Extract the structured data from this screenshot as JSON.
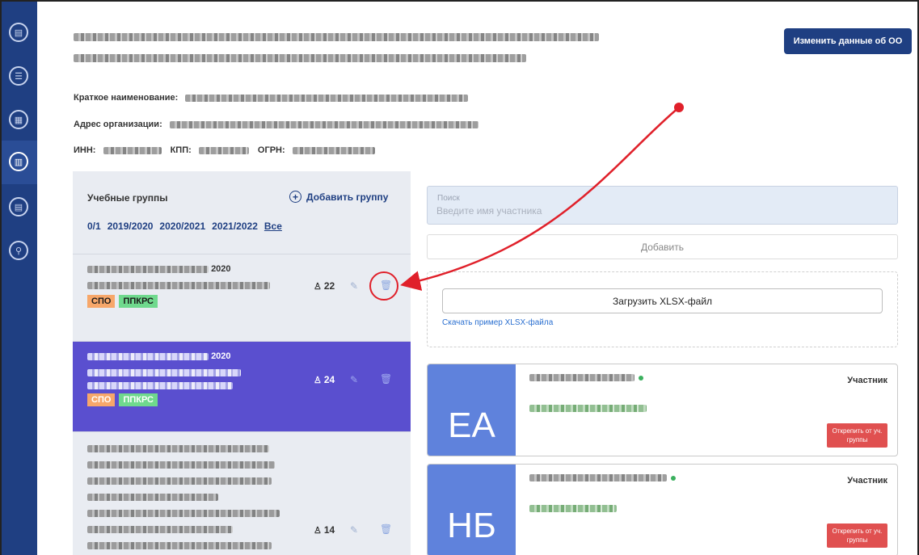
{
  "sidebar": {
    "items": [
      {
        "icon": "document-icon",
        "glyph": "▤"
      },
      {
        "icon": "list-icon",
        "glyph": "☰"
      },
      {
        "icon": "building-icon",
        "glyph": "▦"
      },
      {
        "icon": "calculator-icon",
        "glyph": "▥"
      },
      {
        "icon": "report-icon",
        "glyph": "▤"
      },
      {
        "icon": "user-icon",
        "glyph": "⚲"
      }
    ]
  },
  "header": {
    "edit_button": "Изменить данные об ОО"
  },
  "org": {
    "short_name_label": "Краткое наименование:",
    "address_label": "Адрес организации:",
    "inn_label": "ИНН:",
    "kpp_label": "КПП:",
    "ogrn_label": "ОГРН:"
  },
  "groups": {
    "title": "Учебные группы",
    "add_label": "Добавить группу",
    "years": [
      "0/1",
      "2019/2020",
      "2020/2021",
      "2021/2022",
      "Все"
    ],
    "cards": [
      {
        "year": "2020",
        "count": "22",
        "tags": [
          "СПО",
          "ППКРС"
        ],
        "active": false
      },
      {
        "year": "2020",
        "count": "24",
        "tags": [
          "СПО",
          "ППКРС"
        ],
        "active": true
      },
      {
        "year": "",
        "count": "14",
        "tags": [],
        "active": false
      }
    ]
  },
  "search": {
    "label": "Поиск",
    "placeholder": "Введите имя участника"
  },
  "add_button": "Добавить",
  "upload": {
    "button": "Загрузить XLSX-файл",
    "sample_link": "Скачать пример XLSX-файла"
  },
  "members": [
    {
      "initials": "ЕА",
      "role": "Участник",
      "detach": "Открепить от уч. группы"
    },
    {
      "initials": "НБ",
      "role": "Участник",
      "detach": "Открепить от уч. группы"
    }
  ],
  "colors": {
    "sidebar": "#1f3f82",
    "accent": "#1f3f82",
    "active_group": "#5a4fcf",
    "tag_spo": "#f7a76a",
    "tag_ppkrs": "#6fd98d",
    "avatar": "#5f82dc",
    "danger": "#e05050",
    "annotation": "#e0202a"
  }
}
